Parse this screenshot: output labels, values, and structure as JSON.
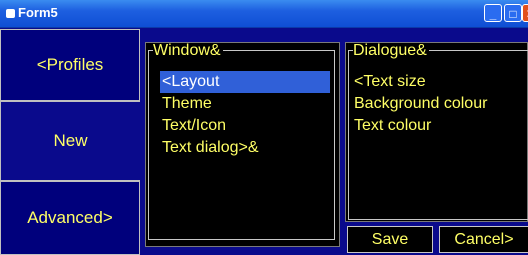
{
  "window": {
    "title": "Form5",
    "minimize_glyph": "_",
    "maximize_glyph": "□",
    "close_glyph": "✕"
  },
  "sidebar": {
    "items": [
      {
        "label": "<Profiles"
      },
      {
        "label": "New"
      },
      {
        "label": "Advanced>"
      }
    ]
  },
  "window_group": {
    "title": "Window&",
    "items": [
      "<Layout",
      "Theme",
      "Text/Icon",
      "Text dialog>&"
    ],
    "selected": "<Layout"
  },
  "dialogue_group": {
    "title": "Dialogue&",
    "items": [
      "<Text size",
      "Background colour",
      "Text colour"
    ]
  },
  "buttons": {
    "save": "Save",
    "cancel": "Cancel>"
  },
  "colors": {
    "background": "#0a0a8c",
    "text": "#ffff66",
    "selection": "#3060d8"
  }
}
